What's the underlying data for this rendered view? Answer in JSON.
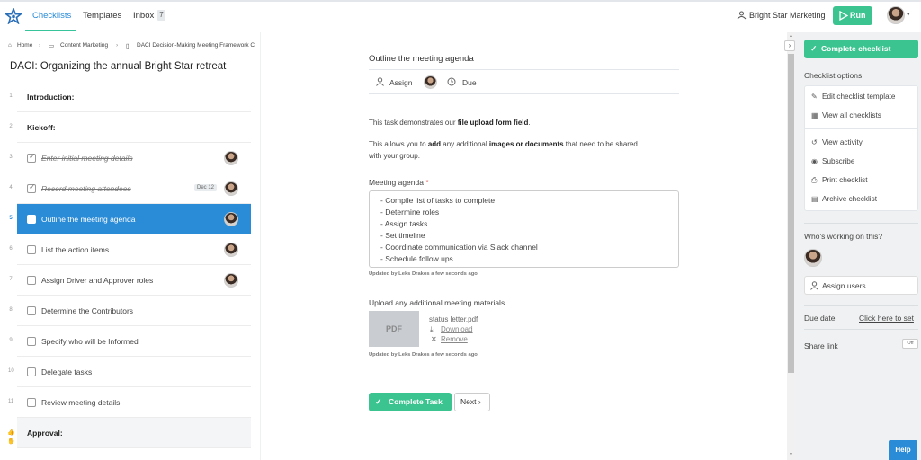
{
  "topbar": {
    "tabs": [
      "Checklists",
      "Templates",
      "Inbox"
    ],
    "inbox_count": "7",
    "org_name": "Bright Star Marketing",
    "run_label": "Run"
  },
  "breadcrumb": [
    "Home",
    "Content Marketing",
    "DACI Decision-Making Meeting Framework C"
  ],
  "checklist_title": "DACI: Organizing the annual Bright Star retreat",
  "tasks": [
    {
      "num": "1",
      "label": "Introduction:",
      "type": "heading"
    },
    {
      "num": "2",
      "label": "Kickoff:",
      "type": "heading"
    },
    {
      "num": "3",
      "label": "Enter initial meeting details",
      "type": "done"
    },
    {
      "num": "4",
      "label": "Record meeting attendees",
      "type": "done",
      "due": "Dec 12"
    },
    {
      "num": "5",
      "label": "Outline the meeting agenda",
      "type": "active"
    },
    {
      "num": "6",
      "label": "List the action items",
      "type": "task"
    },
    {
      "num": "7",
      "label": "Assign Driver and Approver roles",
      "type": "task"
    },
    {
      "num": "8",
      "label": "Determine the Contributors",
      "type": "task"
    },
    {
      "num": "9",
      "label": "Specify who will be Informed",
      "type": "task"
    },
    {
      "num": "10",
      "label": "Delegate tasks",
      "type": "task"
    },
    {
      "num": "11",
      "label": "Review meeting details",
      "type": "task"
    },
    {
      "num": "",
      "label": "Approval:",
      "type": "approval"
    }
  ],
  "task_detail": {
    "title": "Outline the meeting agenda",
    "assign_label": "Assign",
    "due_label": "Due",
    "intro_1_pre": "This task demonstrates our ",
    "intro_1_bold": "file upload form field",
    "intro_1_post": ".",
    "intro_2_pre": "This allows you to ",
    "intro_2_bold1": "add",
    "intro_2_mid": " any additional ",
    "intro_2_bold2": "images or documents",
    "intro_2_post": " that need to be shared",
    "intro_2_line2": "with your group.",
    "agenda_label": "Meeting agenda",
    "agenda_required": "*",
    "agenda_items": [
      "- Compile list of tasks to complete",
      "- Determine roles",
      "- Assign tasks",
      "- Set timeline",
      "- Coordinate communication via Slack channel",
      "- Schedule follow ups"
    ],
    "updated_by_1": "Updated by Leks Drakos a few seconds ago",
    "upload_label": "Upload any additional meeting materials",
    "file_type": "PDF",
    "file_name": "status letter.pdf",
    "download_label": "Download",
    "remove_label": "Remove",
    "updated_by_2": "Updated by Leks Drakos a few seconds ago",
    "complete_task_label": "Complete Task",
    "next_label": "Next"
  },
  "right_panel": {
    "complete_checklist_label": "Complete checklist",
    "options_heading": "Checklist options",
    "options": [
      {
        "icon": "pencil-icon",
        "label": "Edit checklist template"
      },
      {
        "icon": "table-icon",
        "label": "View all checklists"
      },
      {
        "icon": "history-icon",
        "label": "View activity"
      },
      {
        "icon": "eye-icon",
        "label": "Subscribe"
      },
      {
        "icon": "printer-icon",
        "label": "Print checklist"
      },
      {
        "icon": "archive-icon",
        "label": "Archive checklist"
      }
    ],
    "working_heading": "Who's working on this?",
    "assign_users_label": "Assign users",
    "due_date_label": "Due date",
    "due_date_link": "Click here to set",
    "share_link_label": "Share link",
    "share_toggle": "Off"
  },
  "help_label": "Help",
  "colors": {
    "accent": "#2a8bd7",
    "success": "#3bc48f"
  }
}
